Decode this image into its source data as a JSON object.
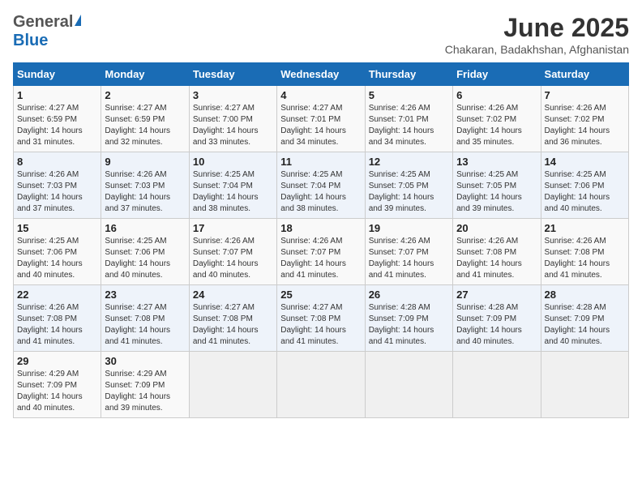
{
  "header": {
    "logo_general": "General",
    "logo_blue": "Blue",
    "month_year": "June 2025",
    "location": "Chakaran, Badakhshan, Afghanistan"
  },
  "weekdays": [
    "Sunday",
    "Monday",
    "Tuesday",
    "Wednesday",
    "Thursday",
    "Friday",
    "Saturday"
  ],
  "weeks": [
    [
      {
        "day": "1",
        "sunrise": "Sunrise: 4:27 AM",
        "sunset": "Sunset: 6:59 PM",
        "daylight": "Daylight: 14 hours and 31 minutes."
      },
      {
        "day": "2",
        "sunrise": "Sunrise: 4:27 AM",
        "sunset": "Sunset: 6:59 PM",
        "daylight": "Daylight: 14 hours and 32 minutes."
      },
      {
        "day": "3",
        "sunrise": "Sunrise: 4:27 AM",
        "sunset": "Sunset: 7:00 PM",
        "daylight": "Daylight: 14 hours and 33 minutes."
      },
      {
        "day": "4",
        "sunrise": "Sunrise: 4:27 AM",
        "sunset": "Sunset: 7:01 PM",
        "daylight": "Daylight: 14 hours and 34 minutes."
      },
      {
        "day": "5",
        "sunrise": "Sunrise: 4:26 AM",
        "sunset": "Sunset: 7:01 PM",
        "daylight": "Daylight: 14 hours and 34 minutes."
      },
      {
        "day": "6",
        "sunrise": "Sunrise: 4:26 AM",
        "sunset": "Sunset: 7:02 PM",
        "daylight": "Daylight: 14 hours and 35 minutes."
      },
      {
        "day": "7",
        "sunrise": "Sunrise: 4:26 AM",
        "sunset": "Sunset: 7:02 PM",
        "daylight": "Daylight: 14 hours and 36 minutes."
      }
    ],
    [
      {
        "day": "8",
        "sunrise": "Sunrise: 4:26 AM",
        "sunset": "Sunset: 7:03 PM",
        "daylight": "Daylight: 14 hours and 37 minutes."
      },
      {
        "day": "9",
        "sunrise": "Sunrise: 4:26 AM",
        "sunset": "Sunset: 7:03 PM",
        "daylight": "Daylight: 14 hours and 37 minutes."
      },
      {
        "day": "10",
        "sunrise": "Sunrise: 4:25 AM",
        "sunset": "Sunset: 7:04 PM",
        "daylight": "Daylight: 14 hours and 38 minutes."
      },
      {
        "day": "11",
        "sunrise": "Sunrise: 4:25 AM",
        "sunset": "Sunset: 7:04 PM",
        "daylight": "Daylight: 14 hours and 38 minutes."
      },
      {
        "day": "12",
        "sunrise": "Sunrise: 4:25 AM",
        "sunset": "Sunset: 7:05 PM",
        "daylight": "Daylight: 14 hours and 39 minutes."
      },
      {
        "day": "13",
        "sunrise": "Sunrise: 4:25 AM",
        "sunset": "Sunset: 7:05 PM",
        "daylight": "Daylight: 14 hours and 39 minutes."
      },
      {
        "day": "14",
        "sunrise": "Sunrise: 4:25 AM",
        "sunset": "Sunset: 7:06 PM",
        "daylight": "Daylight: 14 hours and 40 minutes."
      }
    ],
    [
      {
        "day": "15",
        "sunrise": "Sunrise: 4:25 AM",
        "sunset": "Sunset: 7:06 PM",
        "daylight": "Daylight: 14 hours and 40 minutes."
      },
      {
        "day": "16",
        "sunrise": "Sunrise: 4:25 AM",
        "sunset": "Sunset: 7:06 PM",
        "daylight": "Daylight: 14 hours and 40 minutes."
      },
      {
        "day": "17",
        "sunrise": "Sunrise: 4:26 AM",
        "sunset": "Sunset: 7:07 PM",
        "daylight": "Daylight: 14 hours and 40 minutes."
      },
      {
        "day": "18",
        "sunrise": "Sunrise: 4:26 AM",
        "sunset": "Sunset: 7:07 PM",
        "daylight": "Daylight: 14 hours and 41 minutes."
      },
      {
        "day": "19",
        "sunrise": "Sunrise: 4:26 AM",
        "sunset": "Sunset: 7:07 PM",
        "daylight": "Daylight: 14 hours and 41 minutes."
      },
      {
        "day": "20",
        "sunrise": "Sunrise: 4:26 AM",
        "sunset": "Sunset: 7:08 PM",
        "daylight": "Daylight: 14 hours and 41 minutes."
      },
      {
        "day": "21",
        "sunrise": "Sunrise: 4:26 AM",
        "sunset": "Sunset: 7:08 PM",
        "daylight": "Daylight: 14 hours and 41 minutes."
      }
    ],
    [
      {
        "day": "22",
        "sunrise": "Sunrise: 4:26 AM",
        "sunset": "Sunset: 7:08 PM",
        "daylight": "Daylight: 14 hours and 41 minutes."
      },
      {
        "day": "23",
        "sunrise": "Sunrise: 4:27 AM",
        "sunset": "Sunset: 7:08 PM",
        "daylight": "Daylight: 14 hours and 41 minutes."
      },
      {
        "day": "24",
        "sunrise": "Sunrise: 4:27 AM",
        "sunset": "Sunset: 7:08 PM",
        "daylight": "Daylight: 14 hours and 41 minutes."
      },
      {
        "day": "25",
        "sunrise": "Sunrise: 4:27 AM",
        "sunset": "Sunset: 7:08 PM",
        "daylight": "Daylight: 14 hours and 41 minutes."
      },
      {
        "day": "26",
        "sunrise": "Sunrise: 4:28 AM",
        "sunset": "Sunset: 7:09 PM",
        "daylight": "Daylight: 14 hours and 41 minutes."
      },
      {
        "day": "27",
        "sunrise": "Sunrise: 4:28 AM",
        "sunset": "Sunset: 7:09 PM",
        "daylight": "Daylight: 14 hours and 40 minutes."
      },
      {
        "day": "28",
        "sunrise": "Sunrise: 4:28 AM",
        "sunset": "Sunset: 7:09 PM",
        "daylight": "Daylight: 14 hours and 40 minutes."
      }
    ],
    [
      {
        "day": "29",
        "sunrise": "Sunrise: 4:29 AM",
        "sunset": "Sunset: 7:09 PM",
        "daylight": "Daylight: 14 hours and 40 minutes."
      },
      {
        "day": "30",
        "sunrise": "Sunrise: 4:29 AM",
        "sunset": "Sunset: 7:09 PM",
        "daylight": "Daylight: 14 hours and 39 minutes."
      },
      null,
      null,
      null,
      null,
      null
    ]
  ]
}
